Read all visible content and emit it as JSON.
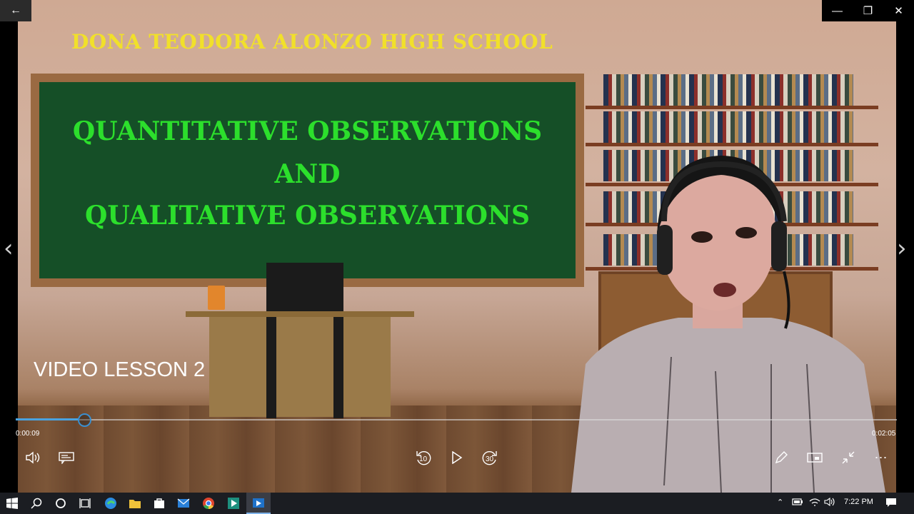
{
  "window": {
    "back_icon": "back-arrow-icon",
    "controls": [
      "minimize-icon",
      "restore-icon",
      "close-icon"
    ]
  },
  "video": {
    "school_title": "DONA TEODORA ALONZO HIGH SCHOOL",
    "board_lines": [
      "QUANTITATIVE OBSERVATIONS",
      "AND",
      "QUALITATIVE OBSERVATIONS"
    ],
    "lesson_label": "VIDEO LESSON 2"
  },
  "player": {
    "current_time": "0:00:09",
    "total_time": "0:02:05",
    "progress": 0.072,
    "skip_back_label": "10",
    "skip_forward_label": "30",
    "accent_color": "#4aa3e0"
  },
  "taskbar": {
    "clock": "7:22 PM",
    "apps": [
      "start-icon",
      "search-icon",
      "cortana-icon",
      "task-view-icon",
      "edge-icon",
      "file-explorer-icon",
      "store-icon",
      "mail-icon",
      "chrome-icon",
      "video-editor-icon",
      "movies-tv-icon"
    ]
  }
}
